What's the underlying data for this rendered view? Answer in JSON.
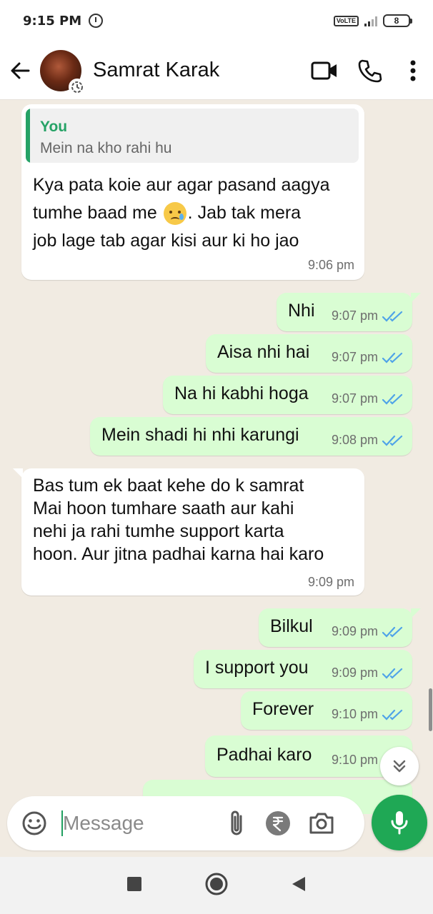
{
  "status_bar": {
    "time": "9:15 PM",
    "network_label": "VoLTE",
    "battery": "8"
  },
  "header": {
    "contact_name": "Samrat Karak"
  },
  "messages": [
    {
      "direction": "incoming",
      "reply_to": {
        "author": "You",
        "text": "Mein na kho rahi hu"
      },
      "lines": [
        "Kya pata koie aur agar pasand aagya",
        "tumhe baad me",
        ".  Jab tak mera",
        "job lage tab agar kisi aur ki ho jao"
      ],
      "time": "9:06 pm"
    },
    {
      "direction": "outgoing",
      "text": "Nhi",
      "time": "9:07 pm"
    },
    {
      "direction": "outgoing",
      "text": "Aisa nhi hai",
      "time": "9:07 pm"
    },
    {
      "direction": "outgoing",
      "text": "Na hi kabhi hoga",
      "time": "9:07 pm"
    },
    {
      "direction": "outgoing",
      "text": "Mein shadi hi nhi karungi",
      "time": "9:08 pm"
    },
    {
      "direction": "incoming",
      "lines": [
        "Bas tum ek baat kehe do k samrat",
        "Mai hoon tumhare saath aur kahi",
        "nehi ja rahi tumhe support karta",
        "hoon. Aur jitna padhai karna hai karo"
      ],
      "time": "9:09 pm"
    },
    {
      "direction": "outgoing",
      "text": "Bilkul",
      "time": "9:09 pm"
    },
    {
      "direction": "outgoing",
      "text": "I support you",
      "time": "9:09 pm"
    },
    {
      "direction": "outgoing",
      "text": "Forever",
      "time": "9:10 pm"
    },
    {
      "direction": "outgoing",
      "text": "Padhai karo",
      "time": "9:10 pm"
    }
  ],
  "composer": {
    "placeholder": "Message"
  },
  "colors": {
    "accent_green": "#1fa855",
    "outgoing_bubble": "#d9fdd3",
    "read_ticks": "#4fa3e8",
    "chat_background": "#f1ebe2"
  },
  "icons": [
    "back-arrow-icon",
    "status-ring-icon",
    "video-call-icon",
    "voice-call-icon",
    "more-options-icon",
    "double-check-icon",
    "emoji-icon",
    "attach-icon",
    "rupee-icon",
    "camera-icon",
    "mic-icon",
    "scroll-down-icon",
    "recents-icon",
    "home-icon",
    "back-nav-icon"
  ]
}
